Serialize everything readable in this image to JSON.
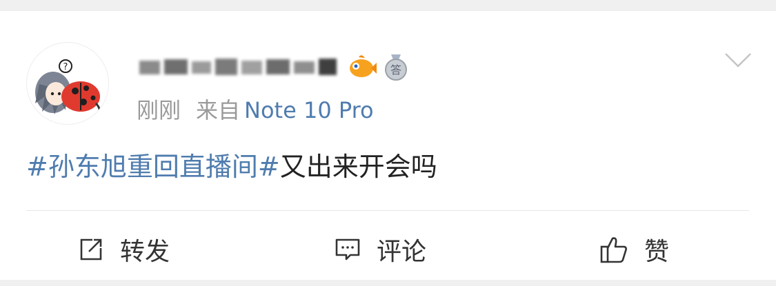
{
  "post": {
    "author": {
      "name_blurred": true,
      "avatar_icon": "ladybug-cartoon-avatar",
      "badges": [
        "fish-badge-icon",
        "answer-medal-icon"
      ],
      "medal_text": "答"
    },
    "time": "刚刚",
    "from_label": "来自",
    "device": "Note 10 Pro",
    "content": {
      "topic": "#孙东旭重回直播间#",
      "text": "又出来开会吗"
    },
    "actions": [
      {
        "label": "转发",
        "icon": "repost-icon"
      },
      {
        "label": "评论",
        "icon": "comment-icon"
      },
      {
        "label": "赞",
        "icon": "thumbs-up-icon"
      }
    ]
  },
  "colors": {
    "link": "#4f7cae",
    "meta": "#9a9a9a",
    "text": "#222222",
    "background": "#f0f0f0"
  }
}
